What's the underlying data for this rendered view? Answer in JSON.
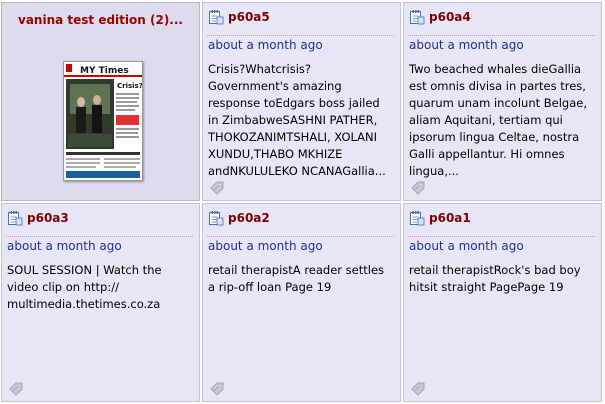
{
  "edition": {
    "title": "vanina test edition (2)...",
    "masthead": "MY Times",
    "headline": "Crisis? What crisis?"
  },
  "pages": [
    {
      "title": "p60a5",
      "date": "about a month ago",
      "text": "Crisis?Whatcrisis?Government's amazing response toEdgars boss jailed in ZimbabweSASHNI PATHER, THOKOZANIMTSHALI, XOLANI XUNDU,THABO MKHIZE andNKULULEKO NCANAGallia..."
    },
    {
      "title": "p60a4",
      "date": "about a month ago",
      "text": "Two beached whales dieGallia est omnis divisa in partes tres, quarum unam incolunt Belgae, aliam Aquitani, tertiam qui ipsorum lingua Celtae, nostra Galli appellantur. Hi omnes lingua,..."
    },
    {
      "title": "p60a3",
      "date": "about a month ago",
      "text": "SOUL SESSION | Watch the video clip on http:// multimedia.thetimes.co.za"
    },
    {
      "title": "p60a2",
      "date": "about a month ago",
      "text": "retail therapistA reader settles a rip-off loan Page 19"
    },
    {
      "title": "p60a1",
      "date": "about a month ago",
      "text": "retail therapistRock's bad boy hitsit straight PagePage 19"
    }
  ],
  "icons": {
    "page": "page-document-icon",
    "tag": "tag-icon"
  },
  "colors": {
    "tile_bg": "#e6e6f6",
    "title": "#800000",
    "date": "#1f2f95"
  }
}
